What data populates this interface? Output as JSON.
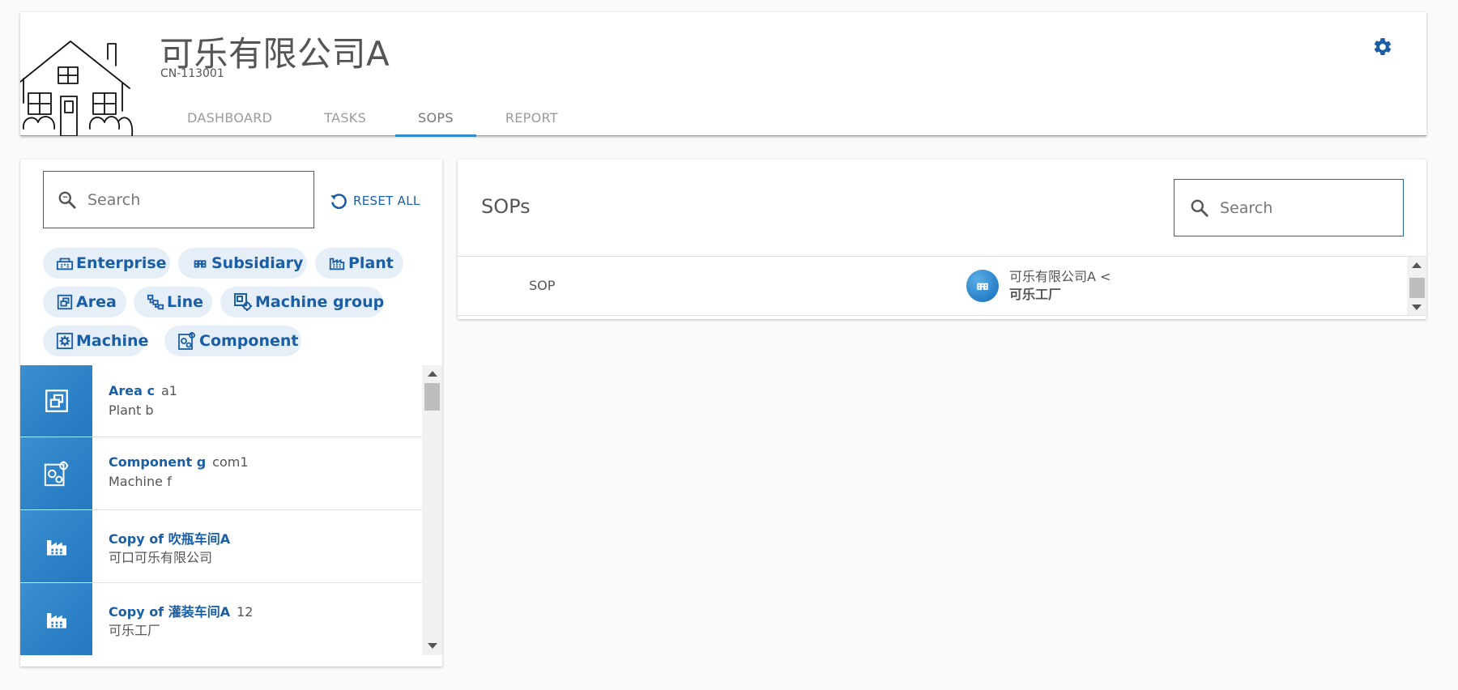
{
  "header": {
    "company_name": "可乐有限公司A",
    "company_code": "CN-113001",
    "tabs": [
      {
        "label": "DASHBOARD",
        "active": false
      },
      {
        "label": "TASKS",
        "active": false
      },
      {
        "label": "SOPS",
        "active": true
      },
      {
        "label": "REPORT",
        "active": false
      }
    ],
    "settings_icon": "gear-icon"
  },
  "filter_panel": {
    "search": {
      "placeholder": "Search",
      "value": ""
    },
    "reset_label": "RESET ALL",
    "chips": [
      {
        "label": "Enterprise",
        "icon": "enterprise-icon"
      },
      {
        "label": "Subsidiary",
        "icon": "subsidiary-icon"
      },
      {
        "label": "Plant",
        "icon": "plant-icon"
      },
      {
        "label": "Area",
        "icon": "area-icon"
      },
      {
        "label": "Line",
        "icon": "line-icon"
      },
      {
        "label": "Machine group",
        "icon": "machine-group-icon"
      },
      {
        "label": "Machine",
        "icon": "machine-icon"
      },
      {
        "label": "Component",
        "icon": "component-icon"
      }
    ],
    "items": [
      {
        "title": "Area c",
        "code": "a1",
        "subtitle": "Plant b",
        "icon": "area-icon"
      },
      {
        "title": "Component g",
        "code": "com1",
        "subtitle": "Machine f",
        "icon": "component-icon"
      },
      {
        "title": "Copy of 吹瓶车间A",
        "code": "",
        "subtitle": "可口可乐有限公司",
        "icon": "plant-icon"
      },
      {
        "title": "Copy of 灌装车间A",
        "code": "12",
        "subtitle": "可乐工厂",
        "icon": "plant-icon"
      }
    ]
  },
  "sops_panel": {
    "title": "SOPs",
    "search": {
      "placeholder": "Search",
      "value": ""
    },
    "rows": [
      {
        "label": "SOP",
        "path": "可乐有限公司A <",
        "target": "可乐工厂",
        "icon": "subsidiary-icon"
      }
    ]
  },
  "colors": {
    "accent": "#1a5ea6",
    "tab_indicator": "#2f8fce",
    "tile": "#2b7fc4"
  }
}
